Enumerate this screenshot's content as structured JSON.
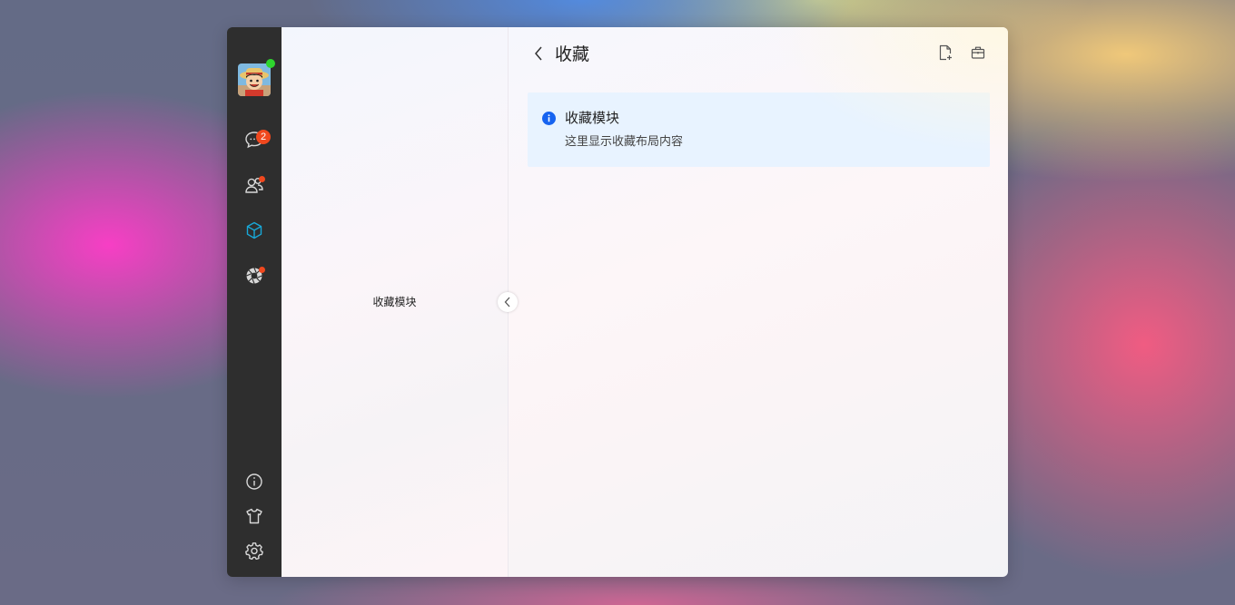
{
  "colors": {
    "nav_bg": "#2e2e2e",
    "nav_icon": "#d8d8d8",
    "nav_active": "#18a8d8",
    "badge": "#f0481e",
    "online": "#2ed52e",
    "alert_bg": "#e8f3ff",
    "alert_icon": "#1663f0"
  },
  "nav": {
    "avatar": {
      "icon": "avatar-image",
      "online": true
    },
    "items": [
      {
        "id": "chat",
        "icon": "chat-bubble-icon",
        "badge": "2"
      },
      {
        "id": "contacts",
        "icon": "contacts-icon",
        "dot": true
      },
      {
        "id": "collections",
        "icon": "cube-icon",
        "active": true
      },
      {
        "id": "moments",
        "icon": "aperture-icon",
        "dot": true
      }
    ],
    "bottom_items": [
      {
        "id": "info",
        "icon": "info-icon"
      },
      {
        "id": "theme",
        "icon": "tshirt-icon"
      },
      {
        "id": "settings",
        "icon": "gear-icon"
      }
    ]
  },
  "list_panel": {
    "label": "收藏模块",
    "collapse_icon": "chevron-left-icon"
  },
  "header": {
    "title": "收藏",
    "back_icon": "chevron-left-icon",
    "actions": [
      {
        "id": "new-note",
        "icon": "file-add-icon"
      },
      {
        "id": "toolbox",
        "icon": "briefcase-icon"
      }
    ]
  },
  "alert": {
    "icon": "info-circle-icon",
    "title": "收藏模块",
    "description": "这里显示收藏布局内容"
  }
}
